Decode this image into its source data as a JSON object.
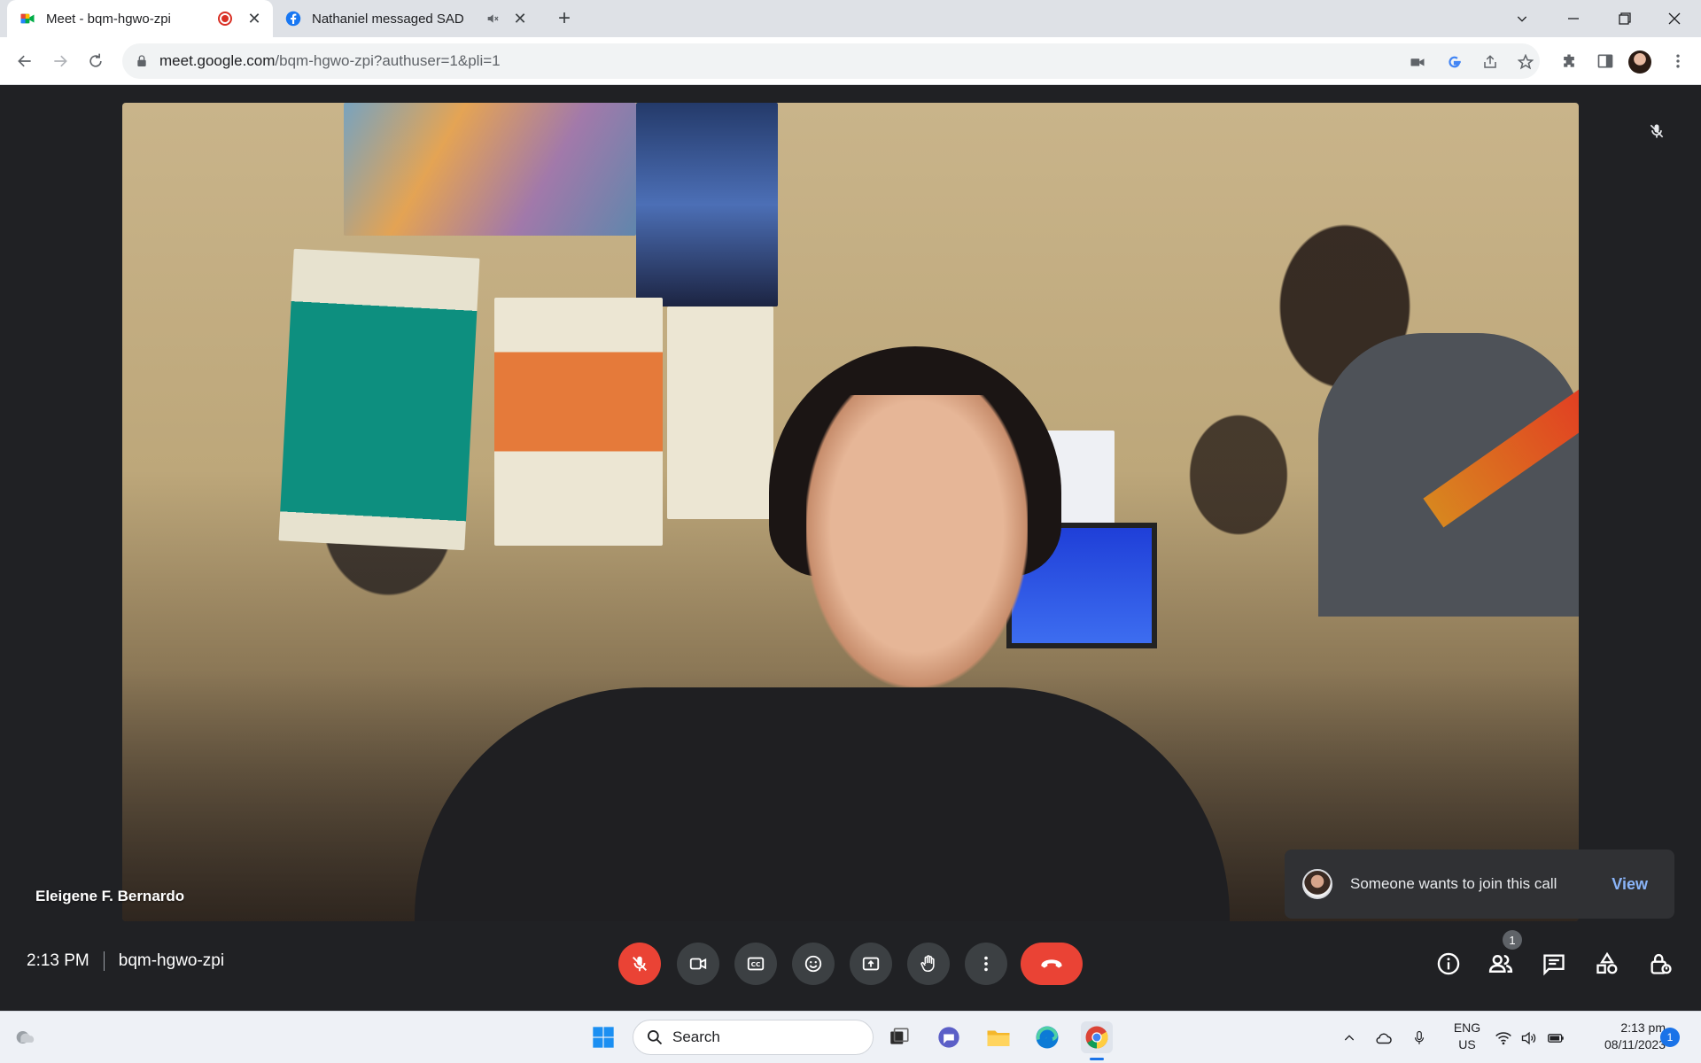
{
  "browser": {
    "tabs": [
      {
        "title": "Meet - bqm-hgwo-zpi",
        "recording": true
      },
      {
        "title": "Nathaniel messaged SAD",
        "muted": true
      }
    ],
    "url_host": "meet.google.com",
    "url_path": "/bqm-hgwo-zpi?authuser=1&pli=1"
  },
  "meet": {
    "participant_name": "Eleigene F. Bernardo",
    "time": "2:13 PM",
    "meeting_code": "bqm-hgwo-zpi",
    "people_count": "1",
    "toast": {
      "message": "Someone wants to join this call",
      "action": "View"
    }
  },
  "taskbar": {
    "search_placeholder": "Search",
    "lang_top": "ENG",
    "lang_bottom": "US",
    "clock_time": "2:13 pm",
    "clock_date": "08/11/2023",
    "notification_count": "1"
  },
  "colors": {
    "end_call": "#ea4335",
    "mic_off": "#ea4335",
    "link": "#8ab4f8",
    "stage_bg": "#202124"
  }
}
